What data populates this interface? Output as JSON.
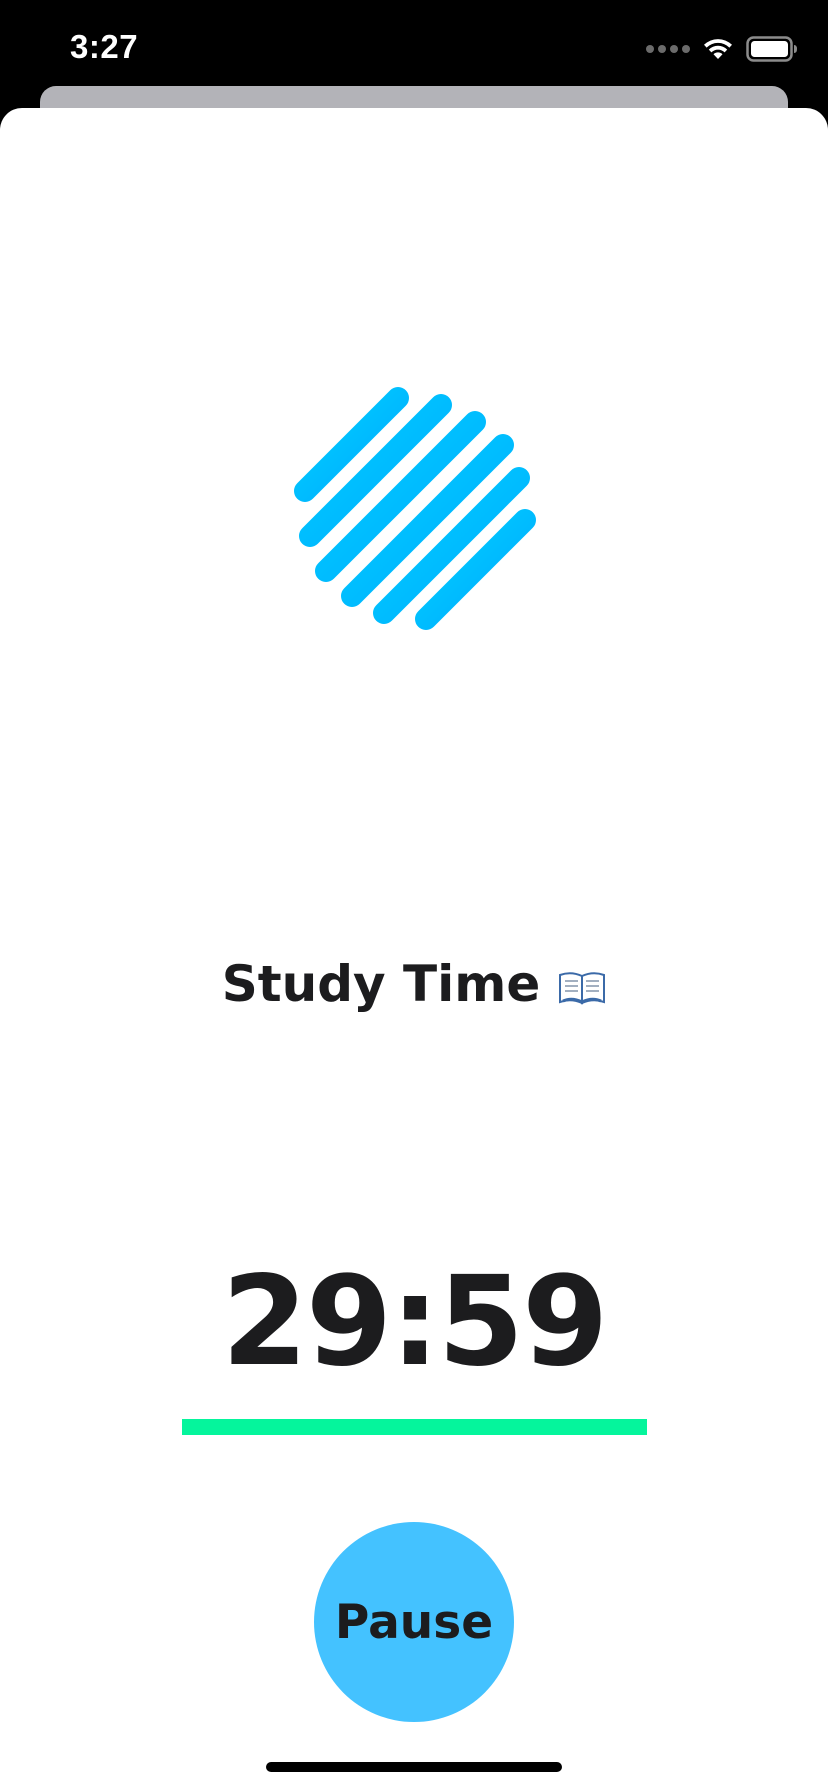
{
  "status_bar": {
    "time": "3:27",
    "icons": [
      "signal-dots-icon",
      "wifi-icon",
      "battery-icon"
    ]
  },
  "logo": {
    "icon": "striped-circle-logo-icon",
    "gradient_colors": [
      "#00d2ff",
      "#00a8ff"
    ]
  },
  "session": {
    "title": "Study Time",
    "emoji": "open-book-icon"
  },
  "timer": {
    "remaining": "29:59",
    "progress_fraction": 1.0,
    "progress_color": "#05f59c"
  },
  "controls": {
    "pause_label": "Pause",
    "button_color": "#44c2ff"
  }
}
